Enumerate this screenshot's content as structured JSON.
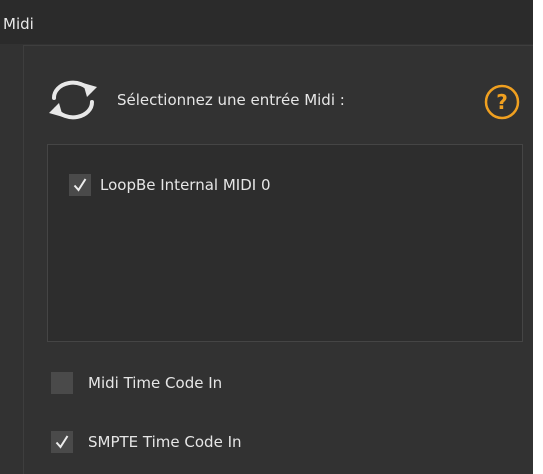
{
  "title": "Midi",
  "midi_input": {
    "prompt": "Sélectionnez une entrée Midi :",
    "refresh_icon": "refresh-icon",
    "help_icon": "question-mark-icon",
    "help_label": "?",
    "accent_color": "#f0a020",
    "devices": [
      {
        "label": "LoopBe Internal MIDI 0",
        "checked": true
      }
    ]
  },
  "options": {
    "mtc": {
      "label": "Midi Time Code In",
      "checked": false
    },
    "smpte": {
      "label": "SMPTE Time Code In",
      "checked": true
    }
  }
}
